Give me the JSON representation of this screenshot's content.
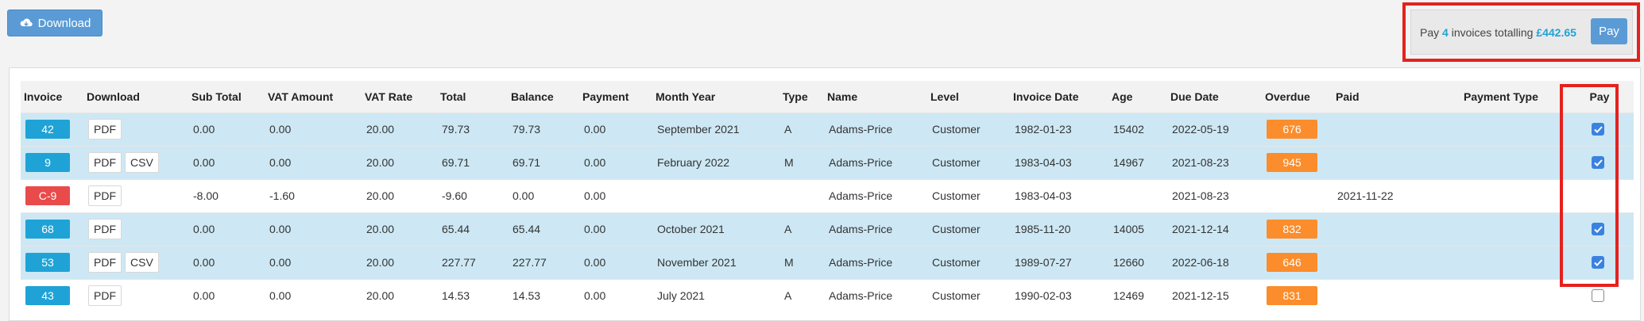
{
  "toolbar": {
    "download_label": "Download",
    "download_icon": "cloud-download-icon"
  },
  "pay_panel": {
    "prefix": "Pay",
    "count": "4",
    "middle": "invoices totalling",
    "total": "£442.65",
    "button_label": "Pay"
  },
  "colors": {
    "primary": "#5b9bd5",
    "invoice_badge": "#1fa3d6",
    "credit_badge": "#e94b4b",
    "overdue_badge": "#fb8d2c",
    "row_highlight": "#cde8f4",
    "highlight_outline": "#e5211d",
    "checkbox_checked": "#3b82e0"
  },
  "table": {
    "headers": [
      "Invoice",
      "Download",
      "Sub Total",
      "VAT Amount",
      "VAT Rate",
      "Total",
      "Balance",
      "Payment",
      "Month Year",
      "Type",
      "Name",
      "Level",
      "Invoice Date",
      "Age",
      "Due Date",
      "Overdue",
      "Paid",
      "Payment Type",
      "Pay"
    ],
    "rows": [
      {
        "invoice": "42",
        "downloads": [
          "PDF"
        ],
        "sub_total": "0.00",
        "vat_amount": "0.00",
        "vat_rate": "20.00",
        "total": "79.73",
        "balance": "79.73",
        "payment": "0.00",
        "month_year": "September 2021",
        "type": "A",
        "name": "Adams-Price",
        "level": "Customer",
        "invoice_date": "1982-01-23",
        "age": "15402",
        "due_date": "2022-05-19",
        "overdue": "676",
        "paid": "",
        "payment_type": "",
        "pay": "checked"
      },
      {
        "invoice": "9",
        "downloads": [
          "PDF",
          "CSV"
        ],
        "sub_total": "0.00",
        "vat_amount": "0.00",
        "vat_rate": "20.00",
        "total": "69.71",
        "balance": "69.71",
        "payment": "0.00",
        "month_year": "February 2022",
        "type": "M",
        "name": "Adams-Price",
        "level": "Customer",
        "invoice_date": "1983-04-03",
        "age": "14967",
        "due_date": "2021-08-23",
        "overdue": "945",
        "paid": "",
        "payment_type": "",
        "pay": "checked"
      },
      {
        "invoice": "C-9",
        "downloads": [
          "PDF"
        ],
        "sub_total": "-8.00",
        "vat_amount": "-1.60",
        "vat_rate": "20.00",
        "total": "-9.60",
        "balance": "0.00",
        "payment": "0.00",
        "month_year": "",
        "type": "",
        "name": "Adams-Price",
        "level": "Customer",
        "invoice_date": "1983-04-03",
        "age": "",
        "due_date": "2021-08-23",
        "overdue": "",
        "paid": "2021-11-22",
        "payment_type": "",
        "pay": "none"
      },
      {
        "invoice": "68",
        "downloads": [
          "PDF"
        ],
        "sub_total": "0.00",
        "vat_amount": "0.00",
        "vat_rate": "20.00",
        "total": "65.44",
        "balance": "65.44",
        "payment": "0.00",
        "month_year": "October 2021",
        "type": "A",
        "name": "Adams-Price",
        "level": "Customer",
        "invoice_date": "1985-11-20",
        "age": "14005",
        "due_date": "2021-12-14",
        "overdue": "832",
        "paid": "",
        "payment_type": "",
        "pay": "checked"
      },
      {
        "invoice": "53",
        "downloads": [
          "PDF",
          "CSV"
        ],
        "sub_total": "0.00",
        "vat_amount": "0.00",
        "vat_rate": "20.00",
        "total": "227.77",
        "balance": "227.77",
        "payment": "0.00",
        "month_year": "November 2021",
        "type": "M",
        "name": "Adams-Price",
        "level": "Customer",
        "invoice_date": "1989-07-27",
        "age": "12660",
        "due_date": "2022-06-18",
        "overdue": "646",
        "paid": "",
        "payment_type": "",
        "pay": "checked"
      },
      {
        "invoice": "43",
        "downloads": [
          "PDF"
        ],
        "sub_total": "0.00",
        "vat_amount": "0.00",
        "vat_rate": "20.00",
        "total": "14.53",
        "balance": "14.53",
        "payment": "0.00",
        "month_year": "July 2021",
        "type": "A",
        "name": "Adams-Price",
        "level": "Customer",
        "invoice_date": "1990-02-03",
        "age": "12469",
        "due_date": "2021-12-15",
        "overdue": "831",
        "paid": "",
        "payment_type": "",
        "pay": "unchecked"
      }
    ]
  }
}
